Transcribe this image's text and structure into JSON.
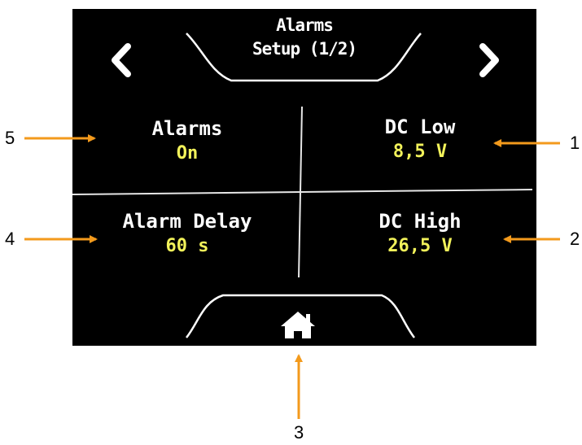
{
  "screen": {
    "title_line1": "Alarms",
    "title_line2": "Setup (1/2)",
    "nav_prev_icon": "chevron-left-icon",
    "nav_next_icon": "chevron-right-icon",
    "home_icon": "home-icon"
  },
  "settings": {
    "alarms": {
      "label": "Alarms",
      "value": "On"
    },
    "dc_low": {
      "label": "DC Low",
      "value": "8,5 V"
    },
    "alarm_delay": {
      "label": "Alarm Delay",
      "value": "60 s"
    },
    "dc_high": {
      "label": "DC High",
      "value": "26,5 V"
    }
  },
  "callouts": {
    "c1": "1",
    "c2": "2",
    "c3": "3",
    "c4": "4",
    "c5": "5"
  },
  "colors": {
    "screen_background": "#000000",
    "label_text": "#ffffff",
    "value_text": "#f2f25a",
    "callout_arrow": "#f39a1c"
  }
}
